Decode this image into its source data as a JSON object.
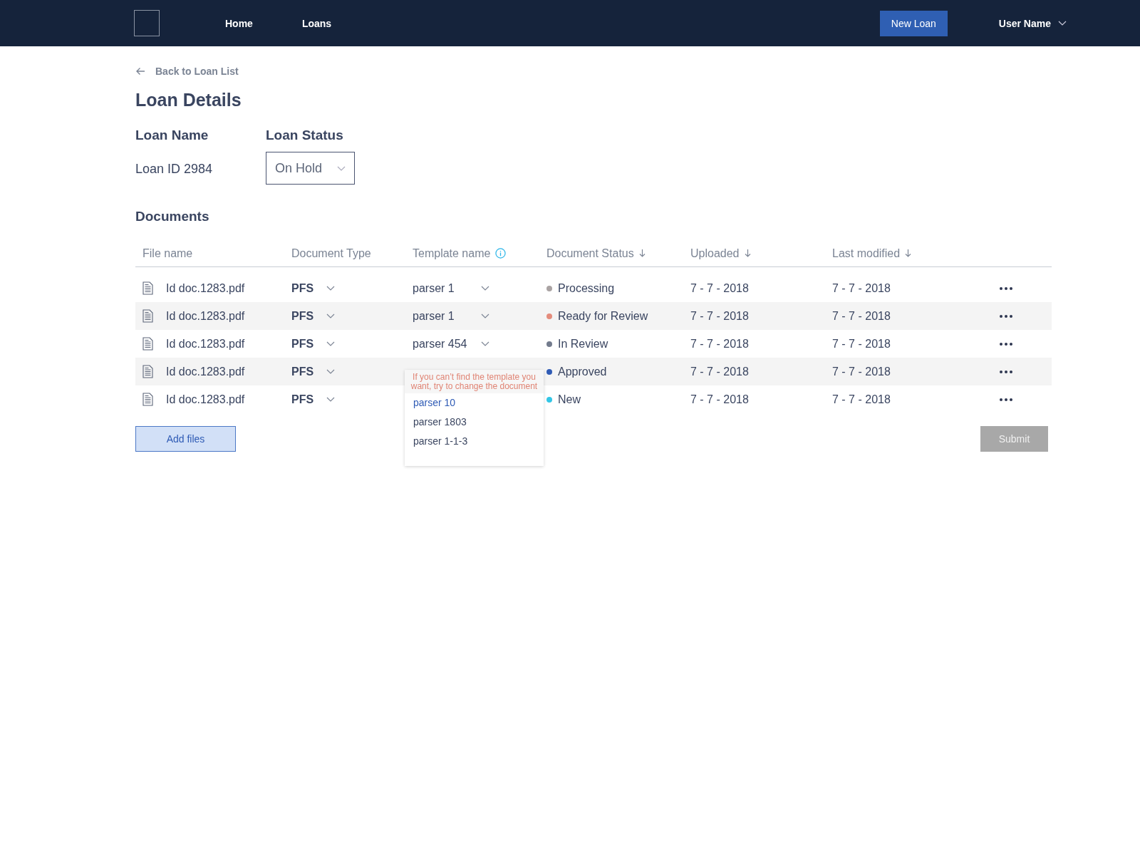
{
  "nav": {
    "links": [
      {
        "label": "Home",
        "selected": false
      },
      {
        "label": "Loans",
        "selected": false
      }
    ],
    "new_button": "New Loan",
    "user": "User Name"
  },
  "back_link": "Back to Loan List",
  "title": "Loan Details",
  "loan_name": {
    "label": "Loan Name",
    "value": "Loan ID 2984"
  },
  "loan_status": {
    "label": "Loan Status",
    "value": "On Hold"
  },
  "documents": {
    "title": "Documents",
    "columns": [
      {
        "label": "File name",
        "sortable": false,
        "info": false
      },
      {
        "label": "Document Type",
        "sortable": false,
        "info": false
      },
      {
        "label": "Template name",
        "sortable": false,
        "info": true
      },
      {
        "label": "Document Status",
        "sortable": true,
        "info": false
      },
      {
        "label": "Uploaded",
        "sortable": true,
        "info": false
      },
      {
        "label": "Last modified",
        "sortable": true,
        "info": false
      }
    ],
    "rows": [
      {
        "file": "Id doc.1283.pdf",
        "type": "PFS",
        "template": "parser 1",
        "status": "Processing",
        "color": "#aaa3a3",
        "uploaded": "7 - 7 - 2018",
        "modified": "7 - 7 - 2018"
      },
      {
        "file": "Id doc.1283.pdf",
        "type": "PFS",
        "template": "parser 1",
        "status": "Ready for Review",
        "color": "#e48c7c",
        "uploaded": "7 - 7 - 2018",
        "modified": "7 - 7 - 2018"
      },
      {
        "file": "Id doc.1283.pdf",
        "type": "PFS",
        "template": "parser 454",
        "status": "In Review",
        "color": "#737b8d",
        "uploaded": "7 - 7 - 2018",
        "modified": "7 - 7 - 2018"
      },
      {
        "file": "Id doc.1283.pdf",
        "type": "PFS",
        "status": "Approved",
        "color": "#2f5bb5",
        "uploaded": "7 - 7 - 2018",
        "modified": "7 - 7 - 2018",
        "menu_open": true
      },
      {
        "file": "Id doc.1283.pdf",
        "type": "PFS",
        "status": "New",
        "color": "#33c6e6",
        "uploaded": "7 - 7 - 2018",
        "modified": "7 - 7 - 2018"
      }
    ],
    "template_menu": {
      "hint": "If you can’t find the template you want, try to change the document",
      "options": [
        {
          "label": "parser 10",
          "selected": true
        },
        {
          "label": "parser 1803",
          "selected": false
        },
        {
          "label": "parser 1-1-3",
          "selected": false
        }
      ]
    }
  },
  "add_button": "Add files",
  "submit": {
    "label": "Submit",
    "disabled": true
  }
}
